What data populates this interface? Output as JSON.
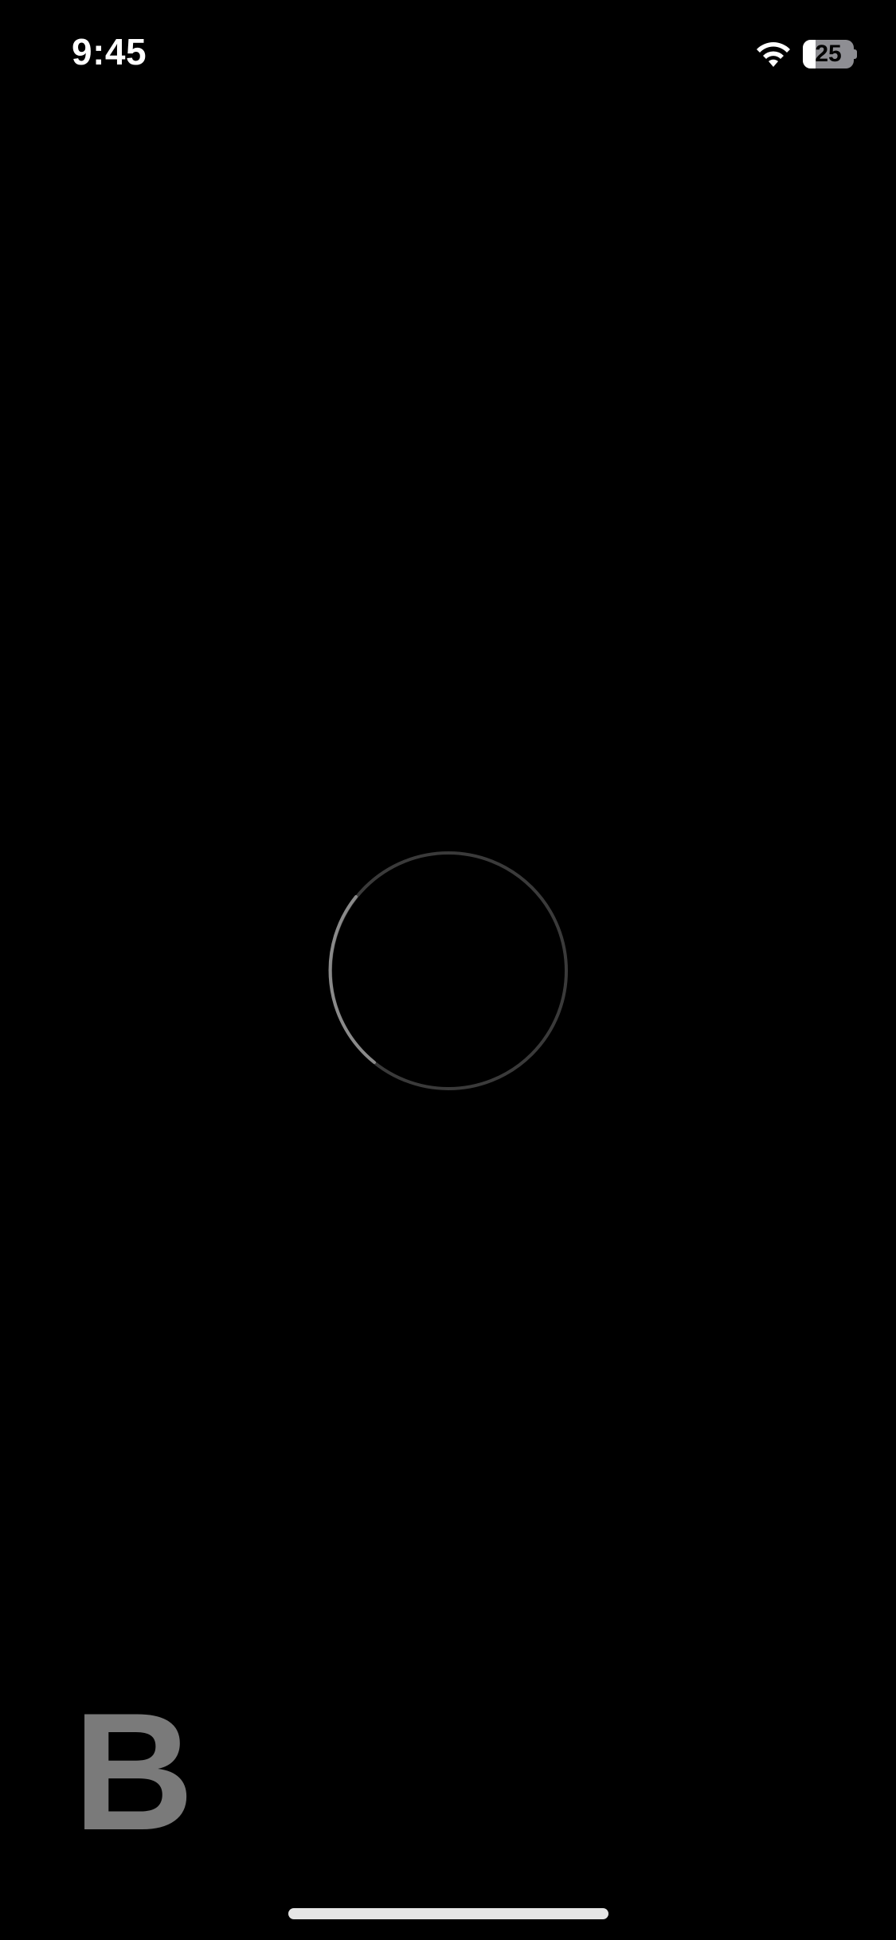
{
  "status_bar": {
    "time": "9:45",
    "wifi_icon": "wifi-icon",
    "battery": {
      "percent_text": "25",
      "level": 0.25
    }
  },
  "loading": {
    "spinner_icon": "loading-spinner-icon",
    "track_color": "#3a3a3a",
    "arc_color": "#8a8a8a"
  },
  "brand": {
    "letter": "B",
    "color": "#7a7a7a"
  },
  "colors": {
    "background": "#000000",
    "text": "#ffffff",
    "home_indicator": "#e5e5e5"
  }
}
